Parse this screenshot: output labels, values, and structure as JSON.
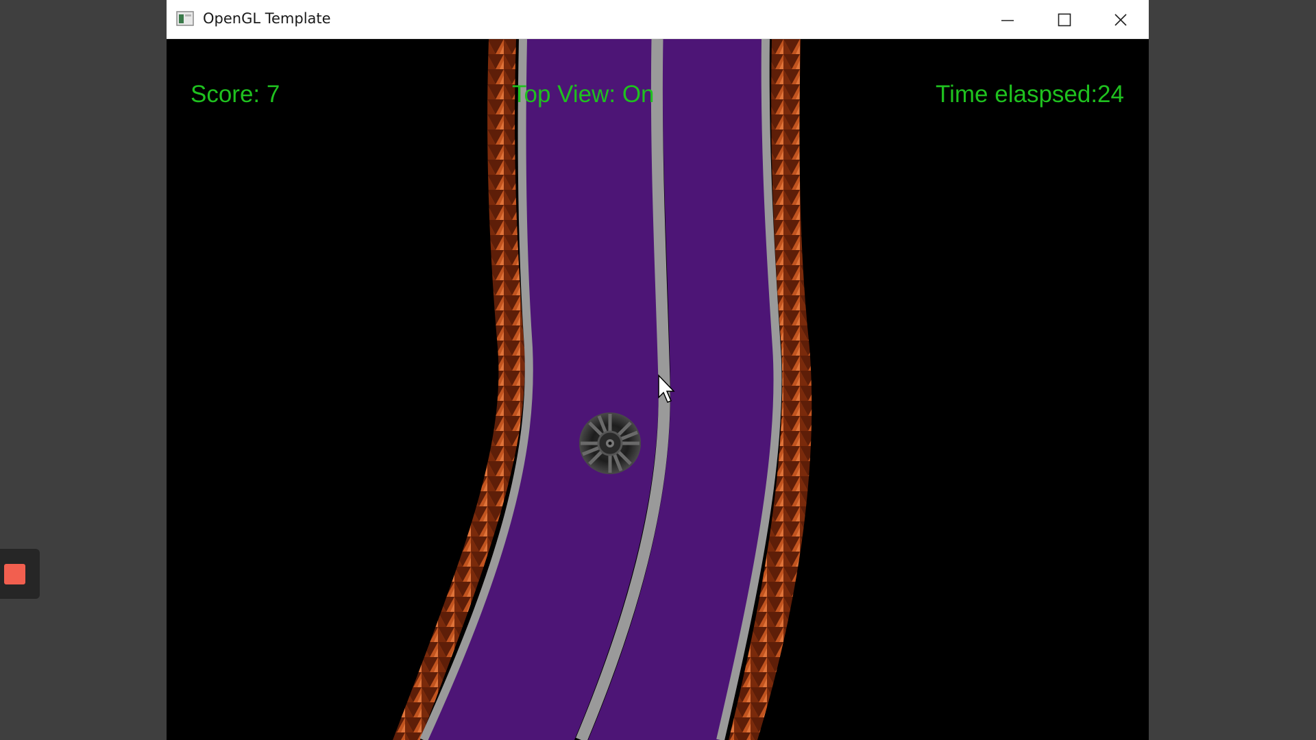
{
  "window": {
    "title": "OpenGL Template",
    "icons": [
      "app-icon",
      "minimize-icon",
      "maximize-icon",
      "close-icon"
    ]
  },
  "hud": {
    "score": "Score: 7",
    "top_view": "Top View: On",
    "time": "Time elaspsed:24"
  },
  "colors": {
    "hud_text": "#1fc11f",
    "road": "#4d1576",
    "lane_edge": "#9a9a9a",
    "spikes": "#b04a1c",
    "background": "#000000",
    "record_button": "#f25f4f"
  }
}
